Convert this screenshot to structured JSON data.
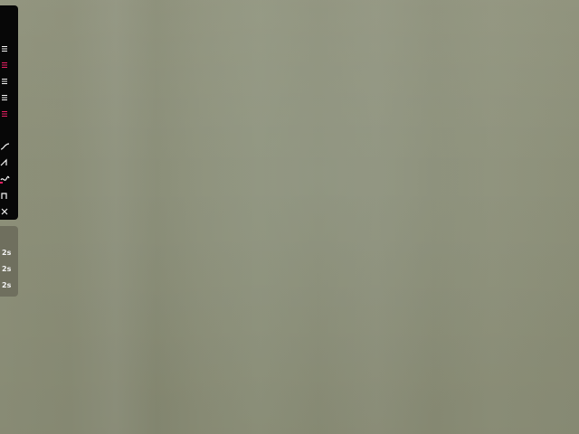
{
  "colors": {
    "panel_dark": "#070707",
    "panel_gray": "#6f6f5e",
    "accent": "#e81f63",
    "icon_white": "#f5f5f5",
    "background": "#8c8f78"
  },
  "toolbar": {
    "list_items": [
      {
        "icon": "menu-lines-icon",
        "selected": false
      },
      {
        "icon": "menu-lines-icon",
        "selected": true
      },
      {
        "icon": "menu-lines-icon",
        "selected": false
      },
      {
        "icon": "menu-lines-icon",
        "selected": false
      },
      {
        "icon": "menu-lines-icon",
        "selected": false
      }
    ],
    "curve_items": [
      {
        "icon": "curve-ease-icon"
      },
      {
        "icon": "curve-linear-icon"
      },
      {
        "icon": "curve-wave-icon"
      },
      {
        "icon": "curve-step-icon"
      },
      {
        "icon": "close-icon"
      }
    ]
  },
  "durations": [
    "2s",
    "2s",
    "2s"
  ]
}
